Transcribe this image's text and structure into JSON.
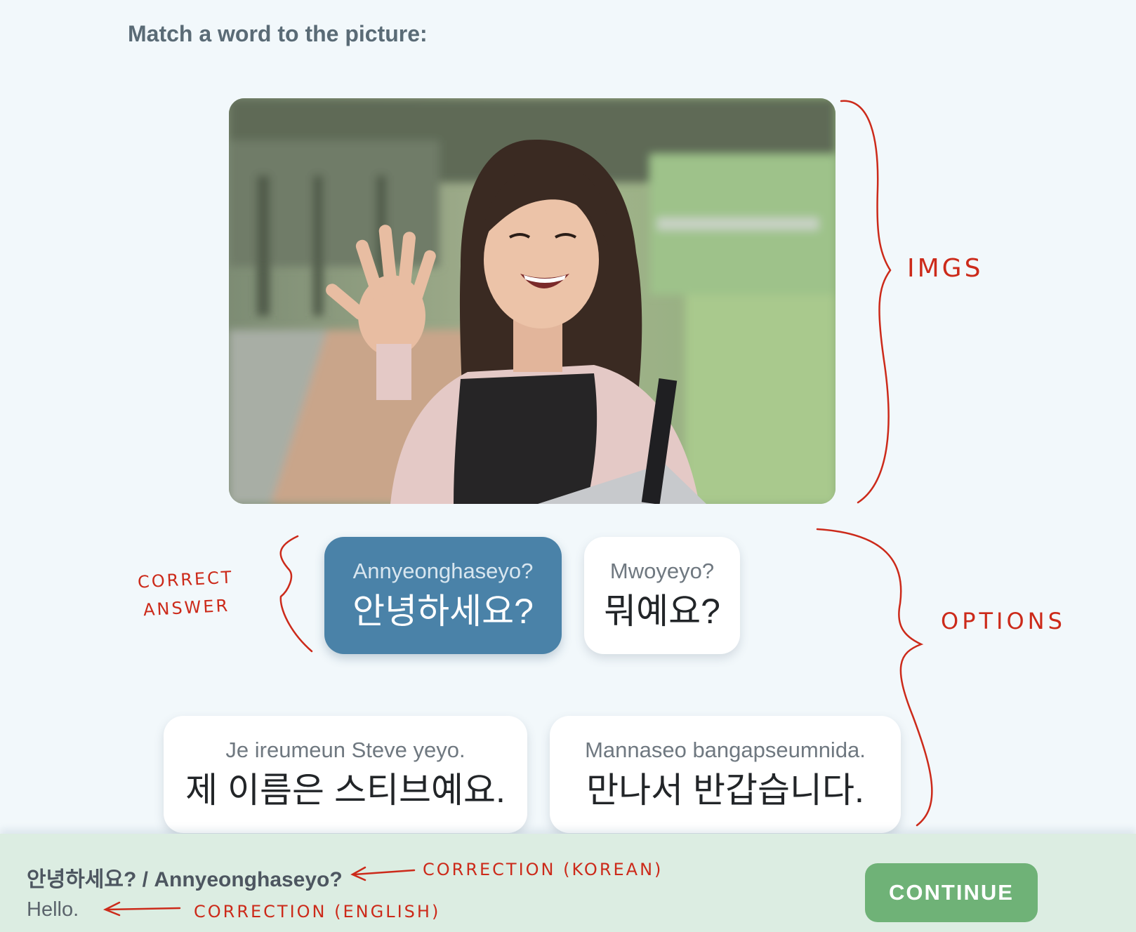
{
  "exercise": {
    "prompt": "Match a word to the picture:",
    "image_alt": "Smiling young woman waving her hand in a park"
  },
  "options": [
    {
      "romanization": "Annyeonghaseyo?",
      "hangul": "안녕하세요?",
      "state": "selected-correct"
    },
    {
      "romanization": "Mwoyeyo?",
      "hangul": "뭐예요?",
      "state": "default"
    },
    {
      "romanization": "Je ireumeun Steve yeyo.",
      "hangul": "제 이름은 스티브예요.",
      "state": "default"
    },
    {
      "romanization": "Mannaseo bangapseumnida.",
      "hangul": "만나서 반갑습니다.",
      "state": "default"
    }
  ],
  "feedback": {
    "correction_korean": "안녕하세요? / Annyeonghaseyo?",
    "correction_english": "Hello.",
    "continue_label": "CONTINUE"
  },
  "annotations": {
    "imgs": "IMGS",
    "correct": "CORRECT",
    "answer": "ANSWER",
    "options": "OPTIONS",
    "correction_korean": "CORRECTION (KOREAN)",
    "correction_english": "CORRECTION (ENGLISH)",
    "color": "#cc2a1a"
  },
  "colors": {
    "background": "#f2f8fb",
    "selected_option": "#4a82a8",
    "feedback_bar": "#dcede2",
    "continue_button": "#6fb277"
  }
}
